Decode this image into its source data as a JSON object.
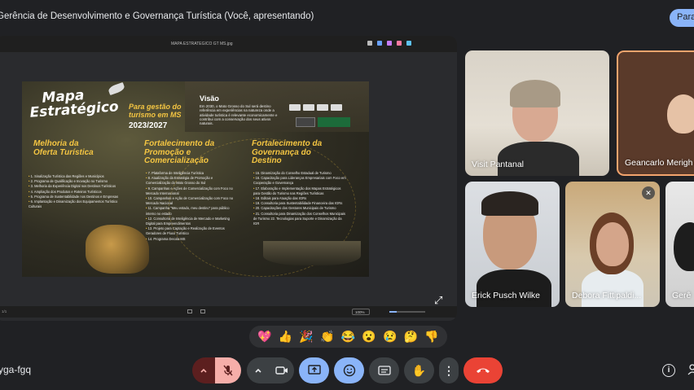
{
  "meeting": {
    "title": "Gerência de Desenvolvimento e Governança Turística (Você, apresentando)",
    "top_button_label": "Para",
    "code": "yga-fgq"
  },
  "viewer": {
    "file_name": "MAPA ESTRATEGICO GT MS.jpg",
    "zoom": "100%",
    "page_info": "1/1"
  },
  "slide": {
    "title_line1": "Mapa",
    "title_line2": "Estratégico",
    "subtitle": "Para gestão do turismo em MS",
    "years": "2023/2027",
    "vision_heading": "Visão",
    "vision_text": "Em 2030, o Mato Grosso do Sul será destino referência em experiências na natureza onde a atividade turística é relevante economicamente e contribui com a conservação dos seus ativos naturais.",
    "columns": [
      {
        "heading": "Melhoria da Oferta Turística",
        "items": [
          "1. Sinalização Turística das Regiões e Municípios",
          "2. Programa de Qualificação e Inovação no Turismo",
          "3. Melhoria da Experiência Digital nos Destinos Turísticos",
          "4. Ampliação dos Produtos e Roteiros Turísticos",
          "5. Programa de Sustentabilidade nos Destinos e Empresas",
          "6. Implantação e Dinamização dos Equipamentos Turístico Culturais"
        ]
      },
      {
        "heading": "Fortalecimento da Promoção e Comercialização",
        "items": [
          "7. Plataforma de Inteligência Turística",
          "8. Atualização da Estratégia de Promoção e Comercialização do Mato Grosso do Sul",
          "9. Campanhas e Ações de Comercialização com Foco no Mercado Internacional",
          "10. Campanhas e Ação de Comercialização com Foco no Mercado Nacional",
          "11. Campanha \"Meu estado, meu destino\" para público interno no estado",
          "12. Consultoria de Inteligência de Mercado e Marketing Digital para Empreendimentos",
          "13. Projeto para Captação e Realização de Eventos Geradores de Fluxo Turístico",
          "14. Programa Decola MS"
        ]
      },
      {
        "heading": "Fortalecimento da Governança do Destino",
        "items": [
          "15. Dinamização do Conselho Estadual de Turismo",
          "16. Capacitação para Lideranças Empresariais com Foco em Cooperação e Governança",
          "17. Elaboração e Implementação dos Mapas Estratégicos para Gestão do Turismo nas Regiões Turísticas",
          "18. Editais para Atuação das IGRs",
          "19. Consultoria para Sustentabilidade Financeira das IGRs",
          "20. Capacitações dos Gestores Municipais de Turismo",
          "21. Consultoria para Dinamização dos Conselhos Municipais de Turismo 22. Tecnologias para Suporte e Dinamização da IGR"
        ]
      }
    ]
  },
  "participants": [
    {
      "name": "Visit Pantanal"
    },
    {
      "name": "Geancarlo Merigh"
    },
    {
      "name": "Erick Pusch Wilke"
    },
    {
      "name": "Debora Fittipaldi..."
    },
    {
      "name": "Gerê"
    }
  ],
  "reactions": [
    "💖",
    "👍",
    "🎉",
    "👏",
    "😂",
    "😮",
    "😢",
    "🤔",
    "👎"
  ],
  "colors": {
    "background": "#202124",
    "accent_blue": "#8ab4f8",
    "end_call_red": "#ea4335",
    "active_speaker_border": "#f2a46d",
    "slide_heading_gold": "#f4c542"
  }
}
